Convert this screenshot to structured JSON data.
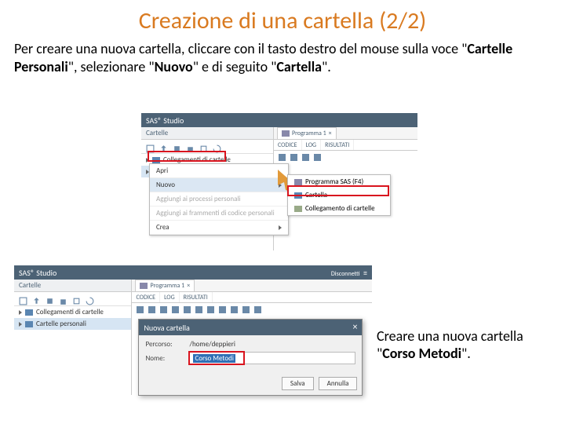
{
  "title": "Creazione di una cartella (2/2)",
  "intro_parts": {
    "p1": "Per creare una nuova cartella, cliccare con il tasto destro del mouse sulla voce \"",
    "b1": "Cartelle Personali",
    "p2": "\", selezionare \"",
    "b2": "Nuovo",
    "p3": "\" e di seguito \"",
    "b3": "Cartella",
    "p4": "\"."
  },
  "sidecap_parts": {
    "p1": "Creare una nuova cartella \"",
    "b1": "Corso Metodi",
    "p2": "\"."
  },
  "app": {
    "name": "SAS® Studio",
    "disconnect": "Disconnetti",
    "panel_header": "Cartelle",
    "tree": {
      "links": "Collegamenti di cartelle",
      "personal": "Cartelle personali"
    },
    "program_tab": "Programma 1",
    "subtabs": {
      "code": "CODICE",
      "log": "LOG",
      "results": "RISULTATI"
    }
  },
  "ctxmenu": {
    "open": "Apri",
    "new": "Nuovo",
    "add_proc": "Aggiungi ai processi personali",
    "add_snip": "Aggiungi ai frammenti di codice personali",
    "create": "Crea"
  },
  "submenu": {
    "prog": "Programma SAS (F4)",
    "folder": "Cartella",
    "link": "Collegamento di cartelle"
  },
  "dialog": {
    "title": "Nuova cartella",
    "path_label": "Percorso:",
    "path_value": "/home/deppieri",
    "name_label": "Nome:",
    "name_value": "Corso Metodi",
    "save": "Salva",
    "cancel": "Annulla"
  }
}
